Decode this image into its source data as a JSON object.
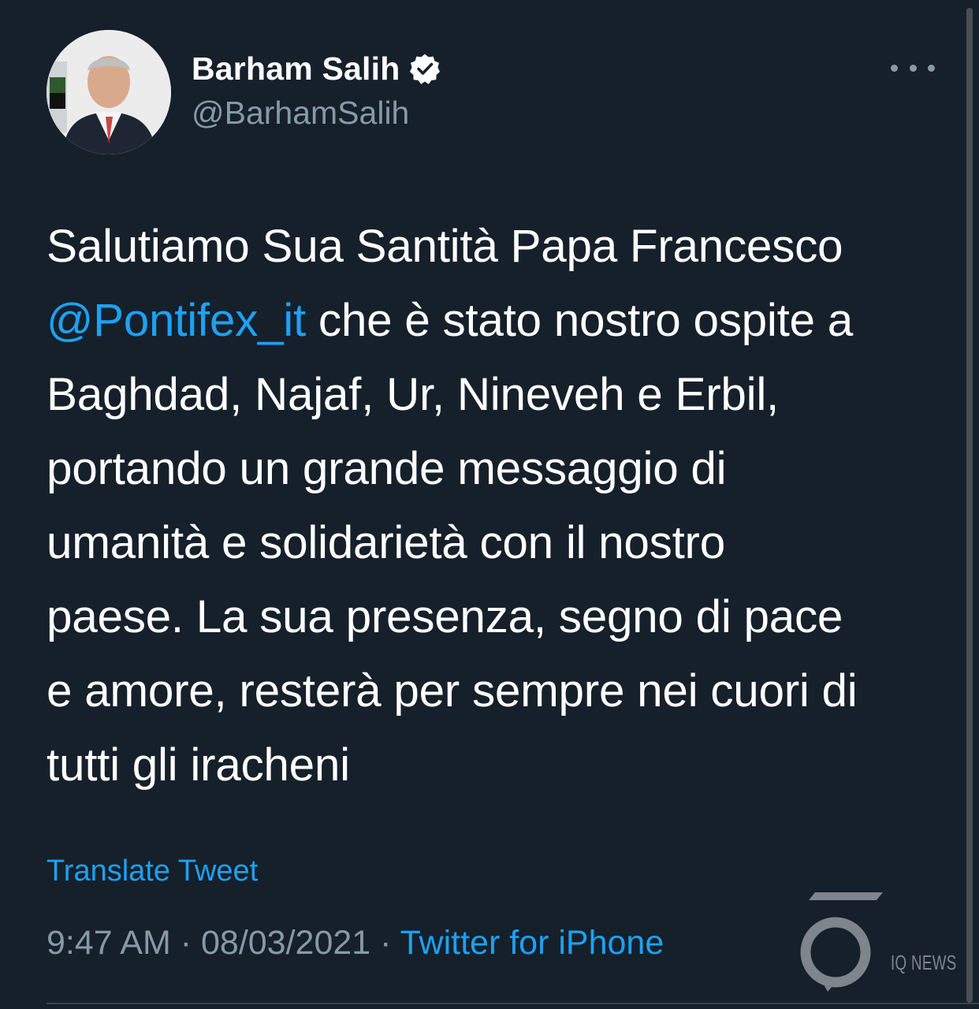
{
  "author": {
    "display_name": "Barham Salih",
    "handle": "@BarhamSalih",
    "verified": true,
    "avatar_icon": "profile-photo"
  },
  "tweet": {
    "lines": [
      [
        {
          "text": "Salutiamo Sua Santità Papa Francesco",
          "mention": false
        }
      ],
      [
        {
          "text": "@Pontifex_it",
          "mention": true
        },
        {
          "text": " che è stato nostro ospite a",
          "mention": false
        }
      ],
      [
        {
          "text": "Baghdad, Najaf, Ur, Nineveh e Erbil,",
          "mention": false
        }
      ],
      [
        {
          "text": "portando un grande messaggio di",
          "mention": false
        }
      ],
      [
        {
          "text": "umanità e solidarietà con il nostro",
          "mention": false
        }
      ],
      [
        {
          "text": "paese. La sua presenza, segno di pace",
          "mention": false
        }
      ],
      [
        {
          "text": "e amore, resterà per sempre nei cuori di",
          "mention": false
        }
      ],
      [
        {
          "text": "tutti gli iracheni",
          "mention": false
        }
      ]
    ]
  },
  "translate_label": "Translate Tweet",
  "meta": {
    "time": "9:47 AM",
    "separator": " · ",
    "date": "08/03/2021",
    "source": "Twitter for iPhone"
  },
  "watermark": {
    "text": "IQ NEWS"
  },
  "colors": {
    "background": "#15202b",
    "accent": "#1da1f2",
    "secondary_text": "#8899a6"
  }
}
